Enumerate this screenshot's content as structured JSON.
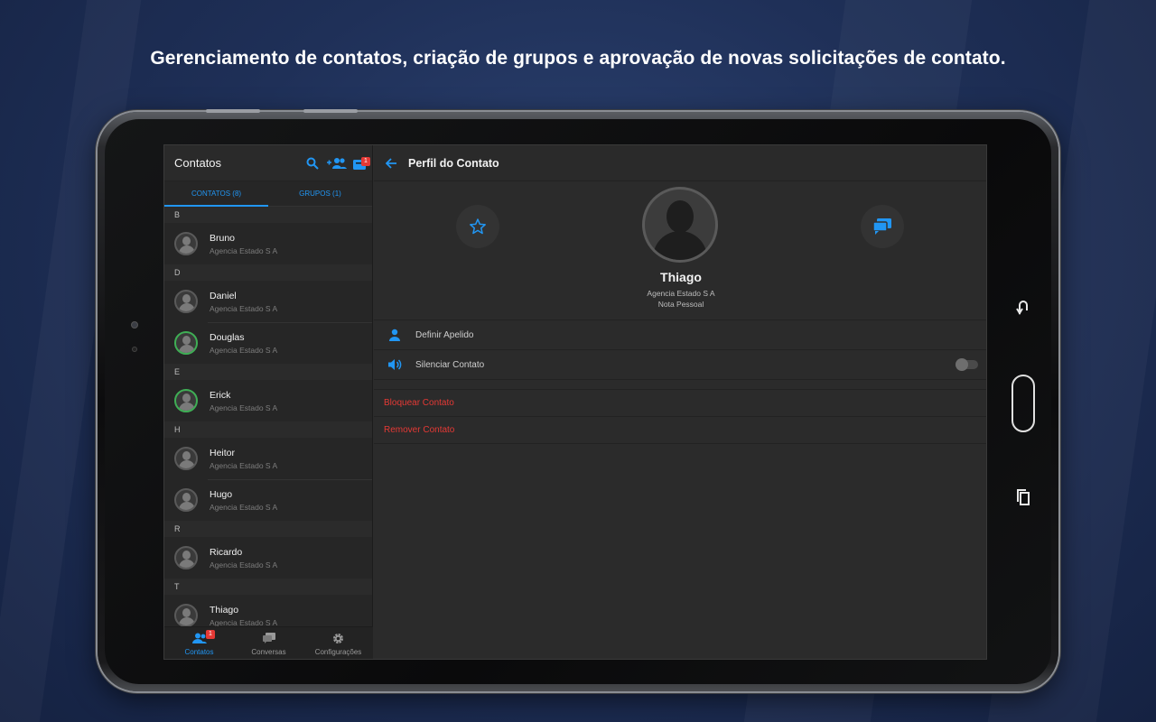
{
  "headline": "Gerenciamento de contatos, criação de grupos e aprovação de novas solicitações de contato.",
  "colors": {
    "accent": "#2196f3",
    "danger": "#e53935",
    "online": "#3fae55",
    "badge": "#e53935"
  },
  "left_panel": {
    "title": "Contatos",
    "icons": {
      "search": "search-icon",
      "add_group": "group-add-icon",
      "requests": "contact-requests-icon"
    },
    "requests_badge": "1",
    "tabs": [
      {
        "label": "CONTATOS (8)",
        "active": true
      },
      {
        "label": "GRUPOS (1)",
        "active": false
      }
    ],
    "sections": [
      {
        "letter": "B",
        "contacts": [
          {
            "name": "Bruno",
            "company": "Agencia Estado S A",
            "online": false
          }
        ]
      },
      {
        "letter": "D",
        "contacts": [
          {
            "name": "Daniel",
            "company": "Agencia Estado S A",
            "online": false
          },
          {
            "name": "Douglas",
            "company": "Agencia Estado S A",
            "online": true
          }
        ]
      },
      {
        "letter": "E",
        "contacts": [
          {
            "name": "Erick",
            "company": "Agencia Estado S A",
            "online": true
          }
        ]
      },
      {
        "letter": "H",
        "contacts": [
          {
            "name": "Heitor",
            "company": "Agencia Estado S A",
            "online": false
          },
          {
            "name": "Hugo",
            "company": "Agencia Estado S A",
            "online": false
          }
        ]
      },
      {
        "letter": "R",
        "contacts": [
          {
            "name": "Ricardo",
            "company": "Agencia Estado S A",
            "online": false
          }
        ]
      },
      {
        "letter": "T",
        "contacts": [
          {
            "name": "Thiago",
            "company": "Agencia Estado S A",
            "online": false
          }
        ]
      }
    ],
    "bottom_nav": [
      {
        "label": "Contatos",
        "icon": "contacts-icon",
        "active": true,
        "badge": "1"
      },
      {
        "label": "Conversas",
        "icon": "chat-icon",
        "active": false
      },
      {
        "label": "Configurações",
        "icon": "gear-icon",
        "active": false
      }
    ]
  },
  "right_panel": {
    "title": "Perfil do Contato",
    "back_icon": "back-arrow-icon",
    "profile": {
      "name": "Thiago",
      "company": "Agencia Estado S A",
      "note": "Nota Pessoal",
      "favorite_icon": "star-icon",
      "chat_icon": "chat-bubble-icon"
    },
    "options": [
      {
        "label": "Definir Apelido",
        "icon": "person-icon"
      },
      {
        "label": "Silenciar Contato",
        "icon": "volume-icon",
        "toggle": false
      }
    ],
    "actions": [
      {
        "label": "Bloquear Contato"
      },
      {
        "label": "Remover Contato"
      }
    ]
  }
}
